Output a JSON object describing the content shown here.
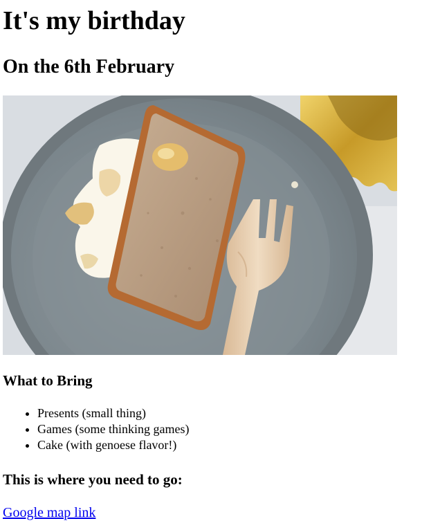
{
  "page": {
    "title": "It's my birthday",
    "subtitle": "On the 6th February"
  },
  "image": {
    "subject": "cake-slice-photo"
  },
  "bring": {
    "heading": "What to Bring",
    "items": [
      "Presents (small thing)",
      "Games (some thinking games)",
      "Cake (with genoese flavor!)"
    ]
  },
  "location": {
    "heading": "This is where you need to go:",
    "link_text": "Google map link"
  },
  "colors": {
    "link": "#0000ee",
    "plate": "#7f8a90",
    "cake": "#b89a7e",
    "crust": "#b56a32",
    "cream": "#fbf8ee",
    "fork": "#e3c9a8",
    "gold_board": "#d4aa3a"
  }
}
